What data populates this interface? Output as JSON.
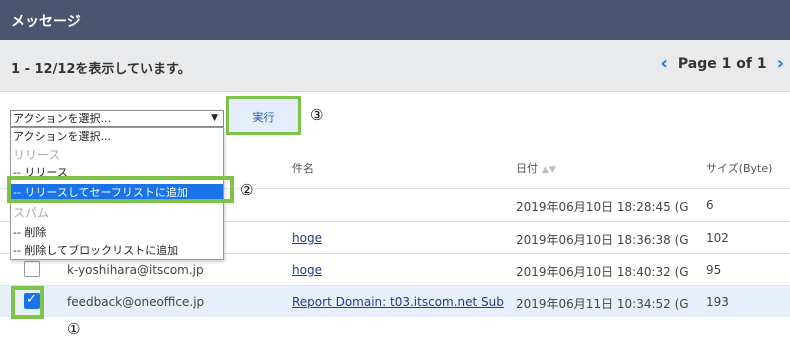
{
  "header": {
    "title": "メッセージ"
  },
  "status": {
    "count_text": "1 - 12/12を表示しています。",
    "page_label": "Page 1 of 1",
    "prev_icon": "chevron-left-icon",
    "next_icon": "chevron-right-icon"
  },
  "toolbar": {
    "action_select_value": "アクションを選択...",
    "execute_label": "実行"
  },
  "dropdown_options": [
    {
      "label": "アクションを選択...",
      "type": "option"
    },
    {
      "label": "リリース",
      "type": "group"
    },
    {
      "label": "-- リリース",
      "type": "option"
    },
    {
      "label": "-- リリースしてセーフリストに追加",
      "type": "option",
      "highlighted": true
    },
    {
      "label": "スパム",
      "type": "group"
    },
    {
      "label": "-- 削除",
      "type": "option"
    },
    {
      "label": "-- 削除してブロックリストに追加",
      "type": "option"
    }
  ],
  "annotations": {
    "one": "①",
    "two": "②",
    "three": "③"
  },
  "table": {
    "columns": {
      "subject": "件名",
      "date": "日付",
      "size": "サイズ(Byte)"
    },
    "rows": [
      {
        "sender": "",
        "subject": "",
        "date": "2019年06月10日 18:28:45 (G",
        "size": "6",
        "checked": false,
        "selected": false
      },
      {
        "sender": "",
        "subject": "hoge",
        "date": "2019年06月10日 18:36:38 (G",
        "size": "102",
        "checked": false,
        "selected": false
      },
      {
        "sender": "k-yoshihara@itscom.jp",
        "subject": "hoge",
        "date": "2019年06月10日 18:40:32 (G",
        "size": "95",
        "checked": false,
        "selected": false
      },
      {
        "sender": "feedback@oneoffice.jp",
        "subject": "Report Domain: t03.itscom.net Sub",
        "date": "2019年06月11日 10:34:52 (G",
        "size": "193",
        "checked": true,
        "selected": true
      }
    ]
  },
  "colors": {
    "header_bg": "#4a5670",
    "annotation_green": "#7ec24a",
    "link_blue": "#1a73e8"
  }
}
